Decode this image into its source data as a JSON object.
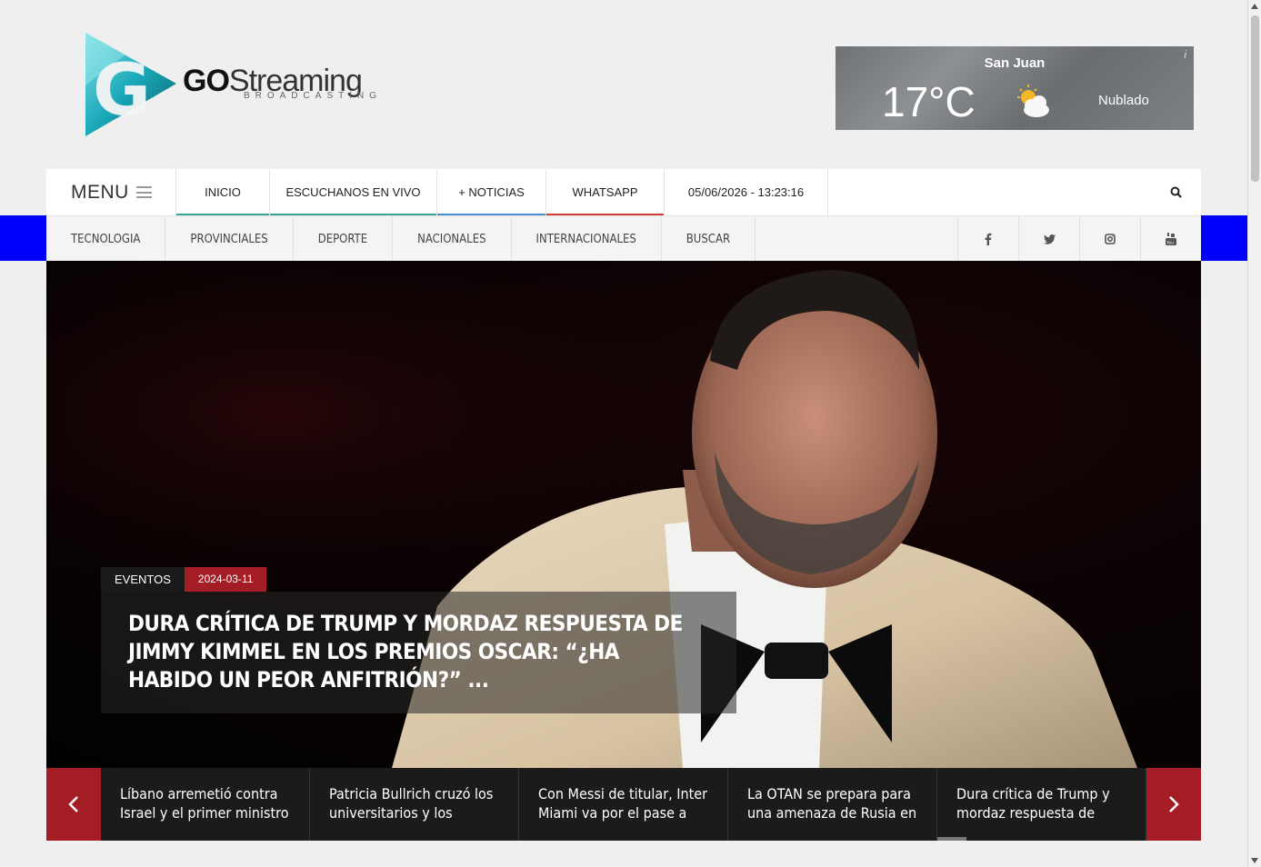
{
  "logo": {
    "brand_bold": "GO",
    "brand_rest": "Streaming",
    "tagline": "BROADCASTING",
    "icon": "go-streaming-logo-icon"
  },
  "weather": {
    "city": "San Juan",
    "temperature": "17°C",
    "condition": "Nublado",
    "info_glyph": "i",
    "icon": "partly-cloudy-icon"
  },
  "topnav": {
    "menu_label": "MENU",
    "items": [
      {
        "label": "INICIO",
        "accent": "#3aa39a"
      },
      {
        "label": "ESCUCHANOS EN VIVO",
        "accent": "#3aa39a"
      },
      {
        "label": "+ NOTICIAS",
        "accent": "#4a8fd1"
      },
      {
        "label": "WHATSAPP",
        "accent": "#d33a3a"
      }
    ],
    "datetime": "05/06/2026 - 13:23:16",
    "search_icon": "search-icon"
  },
  "categories": {
    "items": [
      "TECNOLOGIA",
      "PROVINCIALES",
      "DEPORTE",
      "NACIONALES",
      "INTERNACIONALES",
      "BUSCAR"
    ],
    "social": [
      "facebook-icon",
      "twitter-icon",
      "instagram-icon",
      "youtube-icon"
    ]
  },
  "hero": {
    "category": "EVENTOS",
    "date": "2024-03-11",
    "headline": "DURA CRÍTICA DE TRUMP Y MORDAZ RESPUESTA DE JIMMY KIMMEL EN LOS PREMIOS OSCAR: “¿HA HABIDO UN PEOR ANFITRIÓN?” ..."
  },
  "ticker": {
    "items": [
      "Líbano arremetió contra Israel y el primer ministro",
      "Patricia Bullrich cruzó los universitarios y los comparó",
      "Con Messi de titular, Inter Miami va por el pase a los",
      "La OTAN se prepara para una amenaza de Rusia en el",
      "Dura crítica de Trump y mordaz respuesta de Jimmy"
    ]
  },
  "colors": {
    "accent_red": "#a51d24",
    "blue_band": "#0000ff"
  }
}
